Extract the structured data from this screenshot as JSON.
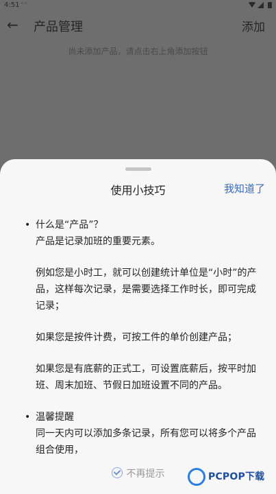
{
  "status_bar": {
    "time": "4:51",
    "extra": "◦◦"
  },
  "app_bar": {
    "title": "产品管理",
    "add_label": "添加"
  },
  "empty_hint": "尚未添加产品，请点击右上角添加按钮",
  "sheet": {
    "title": "使用小技巧",
    "got_it": "我知道了",
    "tips": [
      {
        "bullet": "•",
        "paragraphs": [
          "什么是“产品”？",
          "产品是记录加班的重要元素。",
          "",
          "例如您是小时工，就可以创建统计单位是“小时”的产品，这样每次记录，是需要选择工作时长，即可完成记录；",
          "",
          "如果您是按件计费，可按工件的单价创建产品；",
          "",
          "如果您是有底薪的正式工，可设置底薪后，按平时加班、周末加班、节假日加班设置不同的产品。"
        ]
      },
      {
        "bullet": "•",
        "paragraphs": [
          "温馨提醒",
          "同一天内可以添加多条记录，所有您可以将多个产品组合使用，"
        ]
      }
    ],
    "dont_show": "不再提示"
  },
  "watermark": {
    "text": "PCPOP下载"
  }
}
